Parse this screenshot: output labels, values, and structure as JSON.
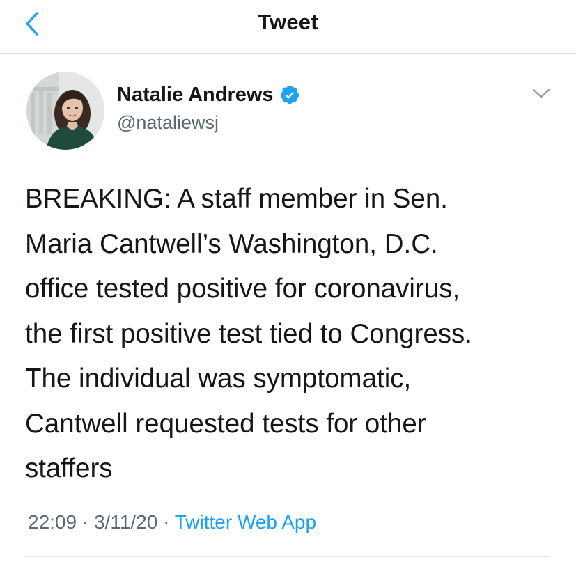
{
  "navbar": {
    "title": "Tweet",
    "back_icon": "chevron-left-icon",
    "accent_color": "#1da1f2"
  },
  "author": {
    "display_name": "Natalie Andrews",
    "handle": "@nataliewsj",
    "verified": true,
    "verified_icon": "verified-badge-icon",
    "verified_color": "#1da1f2",
    "menu_icon": "chevron-down-icon"
  },
  "tweet": {
    "text_lines": [
      "BREAKING: A staff member in Sen.",
      "Maria Cantwell’s Washington, D.C.",
      "office tested positive for coronavirus,",
      "the first positive test tied to Congress.",
      "The individual was symptomatic,",
      "Cantwell requested tests for other",
      "staffers"
    ],
    "time": "22:09",
    "separator": "·",
    "date": "3/11/20",
    "source": "Twitter Web App"
  }
}
